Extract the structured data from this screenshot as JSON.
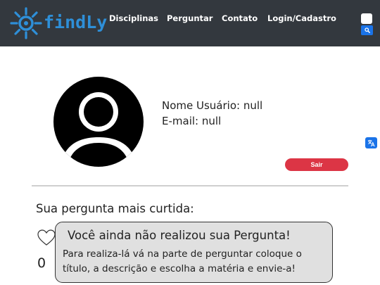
{
  "brand": {
    "name": "findLy",
    "color": "#2e8fd8"
  },
  "nav": {
    "items": [
      {
        "label": "Disciplinas"
      },
      {
        "label": "Perguntar"
      },
      {
        "label": "Contato"
      },
      {
        "label": "Login/Cadastro"
      }
    ]
  },
  "search": {
    "placeholder": "",
    "button_icon": "search-icon"
  },
  "profile": {
    "avatar_icon": "user-avatar-icon",
    "username_line": "Nome Usuário: null",
    "email_line": "E-mail: null",
    "logout_label": "Sair"
  },
  "translate": {
    "icon": "translate-icon"
  },
  "most_liked": {
    "title": "Sua pergunta mais curtida:",
    "heart_icon": "heart-outline-icon",
    "likes": "0",
    "empty_title": "Você ainda não realizou sua Pergunta!",
    "empty_text": "Para realiza-lá vá na parte de perguntar coloque o título, a descrição e escolha a matéria e envie-a!"
  },
  "colors": {
    "navbar": "#33383e",
    "accent": "#1a73e8",
    "danger": "#dc3545",
    "notice_bg": "#e0e0e0"
  }
}
